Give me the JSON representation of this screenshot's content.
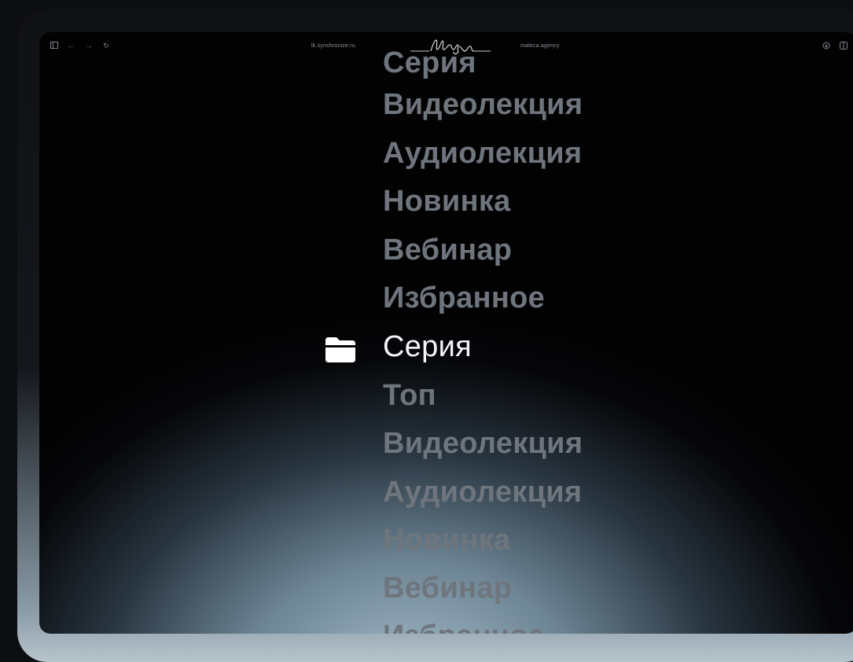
{
  "browser": {
    "url_left": "lk.synchronize.ru",
    "url_right": "maleca.agency",
    "logo_text": "Мауа"
  },
  "menu": {
    "items": [
      {
        "label": "Серия",
        "active": false
      },
      {
        "label": "Видеолекция",
        "active": false
      },
      {
        "label": "Аудиолекция",
        "active": false
      },
      {
        "label": "Новинка",
        "active": false
      },
      {
        "label": "Вебинар",
        "active": false
      },
      {
        "label": "Избранное",
        "active": false
      },
      {
        "label": "Серия",
        "active": true
      },
      {
        "label": "Топ",
        "active": false
      },
      {
        "label": "Видеолекция",
        "active": false
      },
      {
        "label": "Аудиолекция",
        "active": false
      },
      {
        "label": "Новинка",
        "active": false
      },
      {
        "label": "Вебинар",
        "active": false
      },
      {
        "label": "Избранное",
        "active": false
      }
    ],
    "active_icon": "folder-icon"
  },
  "colors": {
    "active_text": "#f2f4f6",
    "inactive_text": "#6e757d",
    "glow": "#aec5d4"
  }
}
